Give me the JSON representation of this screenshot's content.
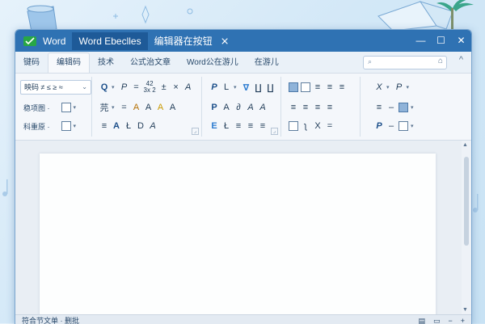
{
  "window": {
    "title_tabs": [
      {
        "label": "Word",
        "active": false
      },
      {
        "label": "Word Ebeclles",
        "active": true
      },
      {
        "label": "编辑器在按钮",
        "active": false
      }
    ],
    "controls": {
      "minimize": "—",
      "maximize": "☐",
      "close": "✕"
    },
    "tab_close": "⨯"
  },
  "menu": {
    "tabs": [
      "键码",
      "编辑码",
      "技术",
      "公式治文章",
      "Word公在游儿",
      "在游儿"
    ],
    "active_index": 1,
    "search_icon": "⌕",
    "search_button": "⌂",
    "collapse_icon": "^"
  },
  "ribbon": {
    "font_group": {
      "combo_value": "映码 ≠ ≤ ≥ ≈",
      "combo_arrow": "⌄",
      "labels": [
        "稳项图 ·",
        "科重原 ·"
      ]
    },
    "math_group": {
      "row1": [
        "Q",
        "P",
        "=",
        "·",
        "A"
      ],
      "frac_top": "42",
      "frac_bottom": "3x  2",
      "row1_tail": [
        "±",
        "×",
        "A"
      ],
      "row2": [
        "芫",
        "=",
        "A",
        "A",
        "A",
        "A"
      ],
      "row3": [
        "≡",
        "A",
        "Ł",
        "D",
        "A"
      ]
    },
    "symbol_group": {
      "row1": [
        "P",
        "L",
        "∇",
        "∐",
        "∐"
      ],
      "row2": [
        "P",
        "A",
        "∂",
        "A",
        "A"
      ],
      "row3": [
        "E",
        "Ł",
        "≡",
        "≡",
        "≡"
      ]
    },
    "layout_group": {
      "row1": [
        "≡",
        "≡",
        "≡"
      ],
      "row2": [
        "≡",
        "≡",
        "≡",
        "≡"
      ],
      "row3": [
        "ʅ",
        "X",
        "="
      ]
    },
    "style_group": {
      "row1": [
        "X",
        "P"
      ],
      "row2": [
        "≡",
        "–"
      ],
      "row3": [
        "P",
        "–"
      ]
    }
  },
  "status": {
    "left": "符合节文单 · 删批",
    "right": [
      "▤",
      "▭",
      "−",
      "+"
    ]
  },
  "colors": {
    "titlebar": "#2f72b3",
    "active_tab": "#1e5a98",
    "accent": "#1c4f8a"
  }
}
